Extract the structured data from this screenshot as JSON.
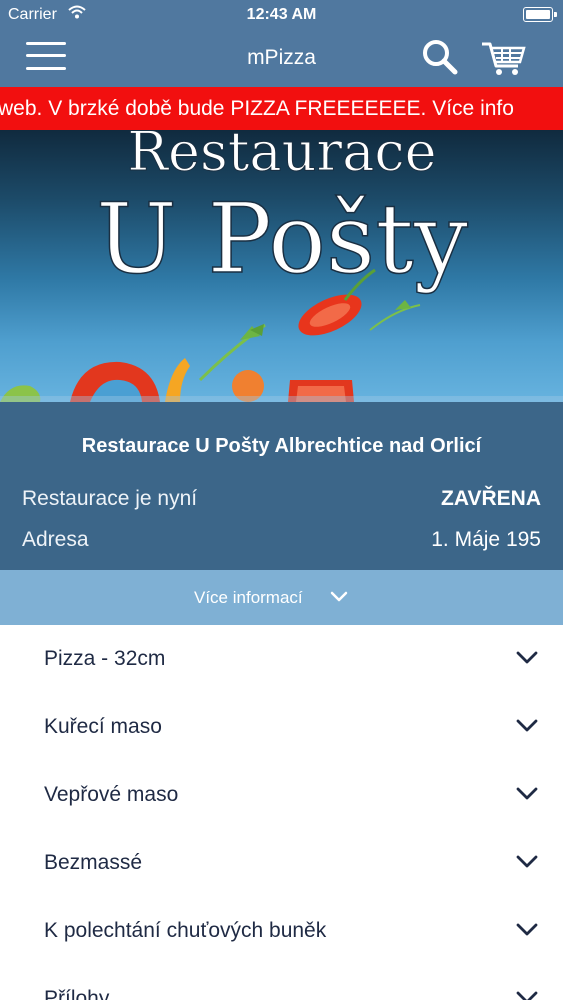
{
  "status_bar": {
    "carrier": "Carrier",
    "time": "12:43 AM"
  },
  "nav": {
    "title": "mPizza",
    "menu_icon": "hamburger-icon",
    "search_icon": "search-icon",
    "cart_icon": "cart-icon"
  },
  "ticker": {
    "text": "web. V brzké době bude PIZZA FREEEEEEE. Více info"
  },
  "banner": {
    "line1": "Restaurace",
    "line2": "U Pošty"
  },
  "restaurant": {
    "name": "Restaurace U Pošty Albrechtice nad Orlicí",
    "status_label": "Restaurace je nyní",
    "status_value": "ZAVŘENA",
    "address_label": "Adresa",
    "address_value": "1. Máje 195"
  },
  "more_info": {
    "label": "Více informací"
  },
  "categories": [
    {
      "label": "Pizza - 32cm"
    },
    {
      "label": "Kuřecí maso"
    },
    {
      "label": "Vepřové maso"
    },
    {
      "label": "Bezmassé"
    },
    {
      "label": "K polechtání chuťových buněk"
    },
    {
      "label": "Přílohy"
    }
  ],
  "colors": {
    "nav_bg": "#50789f",
    "ticker_bg": "#f20f0f",
    "info_bg": "#3c6689",
    "more_info_bg": "#7fb0d4",
    "text_dark": "#1f2a44"
  }
}
